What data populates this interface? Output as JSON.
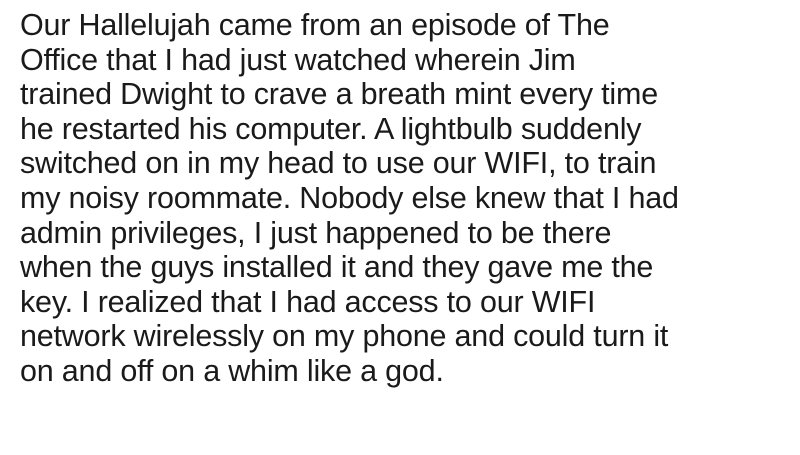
{
  "post": {
    "lines": [
      "Our Hallelujah came from an episode of The",
      "Office that I had just watched wherein Jim",
      "trained Dwight to crave a breath mint every time",
      "he restarted his computer. A lightbulb suddenly",
      "switched on in my head to use our WIFI, to train",
      "my noisy roommate. Nobody else knew that I had",
      "admin privileges, I just happened to be there",
      "when the guys installed it and they gave me the",
      "key. I realized that I had access to our WIFI",
      "network wirelessly on my phone and could turn it",
      "on and off on a whim like a god."
    ]
  }
}
